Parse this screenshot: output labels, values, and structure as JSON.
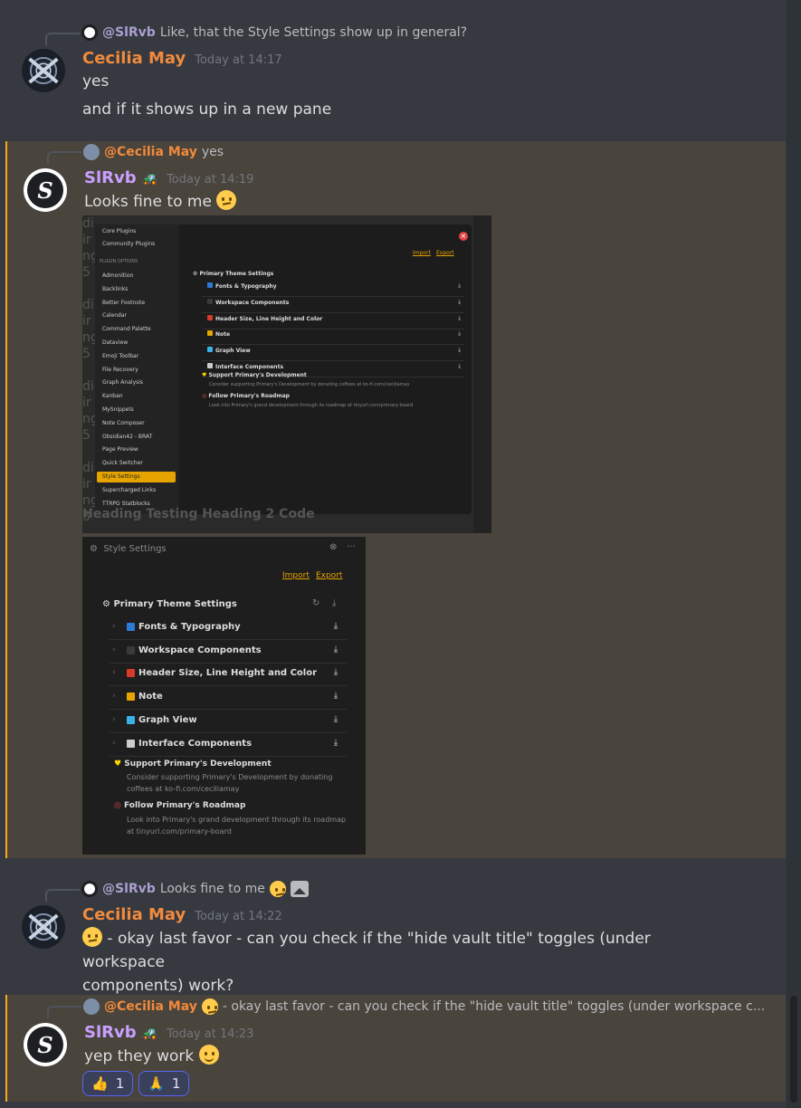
{
  "messages": [
    {
      "reply_to": {
        "mention": "@SlRvb",
        "text": "Like, that the Style Settings show up in general?"
      },
      "author": "Cecilia May",
      "timestamp": "Today at 14:17",
      "lines": [
        "yes",
        "and if it shows up in a new pane"
      ]
    },
    {
      "reply_to": {
        "mention": "@Cecilia May",
        "text": "yes"
      },
      "author": "SlRvb",
      "timestamp": "Today at 14:19",
      "text": "Looks fine to me"
    },
    {
      "reply_to": {
        "mention": "@SlRvb",
        "text": "Looks fine to me"
      },
      "author": "Cecilia May",
      "timestamp": "Today at 14:22",
      "text": "- okay last favor - can you check if the \"hide vault title\" toggles (under workspace",
      "text_cont": "components) work?"
    },
    {
      "reply_to": {
        "mention": "@Cecilia May",
        "text": "- okay last favor - can you check if the \"hide vault title\" toggles (under workspace c..."
      },
      "author": "SlRvb",
      "timestamp": "Today at 14:23",
      "text": "yep they work",
      "reactions": [
        {
          "emoji": "👍",
          "count": "1"
        },
        {
          "emoji": "🙏",
          "count": "1"
        }
      ]
    }
  ],
  "bot_badge_icon": "car-icon",
  "screenshot1": {
    "sidebar_top": [
      "Core Plugins",
      "Community Plugins"
    ],
    "section": "PLUGIN OPTIONS",
    "plugins": [
      "Admonition",
      "Backlinks",
      "Better Footnote",
      "Calendar",
      "Command Palette",
      "Dataview",
      "Emoji Toolbar",
      "File Recovery",
      "Graph Analysis",
      "Kanban",
      "MySnippets",
      "Note Composer",
      "Obsidian42 - BRAT",
      "Page Preview",
      "Quick Switcher",
      "Style Settings",
      "Supercharged Links",
      "TTRPG Statblocks"
    ],
    "active_plugin": "Style Settings",
    "import": "Import",
    "export": "Export",
    "title": "Primary Theme Settings",
    "rows": [
      "Fonts & Typography",
      "Workspace Components",
      "Header Size, Line Height and Color",
      "Note",
      "Graph View",
      "Interface Components"
    ],
    "support_title": "Support Primary's Development",
    "support_desc": "Consider supporting Primary's Development by donating coffees at ko-fi.com/ceciliamay",
    "roadmap_title": "Follow Primary's Roadmap",
    "roadmap_desc": "Look into Primary's grand development through its roadmap at tinyurl.com/primary-board",
    "bottom_ghost": "Heading  Testing      Heading 2 Code"
  },
  "screenshot2": {
    "header": "Style Settings",
    "import": "Import",
    "export": "Export",
    "title": "Primary Theme Settings",
    "rows": [
      "Fonts & Typography",
      "Workspace Components",
      "Header Size, Line Height and Color",
      "Note",
      "Graph View",
      "Interface Components"
    ],
    "row_colors": [
      "#2b7bd6",
      "#3a3a3a",
      "#d63a2b",
      "#e6a400",
      "#3ab0e6",
      "#cccccc"
    ],
    "support_title": "Support Primary's Development",
    "support_desc": "Consider supporting Primary's Development by donating coffees at ko-fi.com/ceciliamay",
    "roadmap_title": "Follow Primary's Roadmap",
    "roadmap_desc": "Look into Primary's grand development through its roadmap at tinyurl.com/primary-board"
  },
  "colors": {
    "cecilia": "#f28a3c",
    "slrvb": "#c9a0ff",
    "accent": "#faa81a",
    "link": "#e6a400"
  }
}
